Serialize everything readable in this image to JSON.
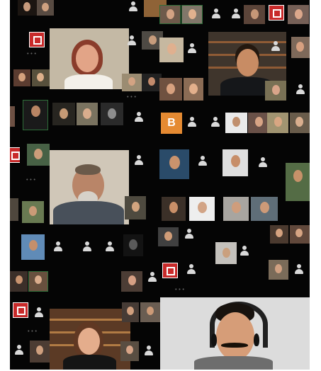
{
  "screen": {
    "title": "",
    "background": "#050505"
  },
  "controls": {
    "more_label": "•••"
  },
  "featured": {
    "avatar_initial": "B"
  },
  "colors": {
    "accent_logo": "#c82a2a",
    "active_border": "#2e6d39",
    "avatar_orange": "#e58a32",
    "label_gray": "#cfcfcf"
  }
}
